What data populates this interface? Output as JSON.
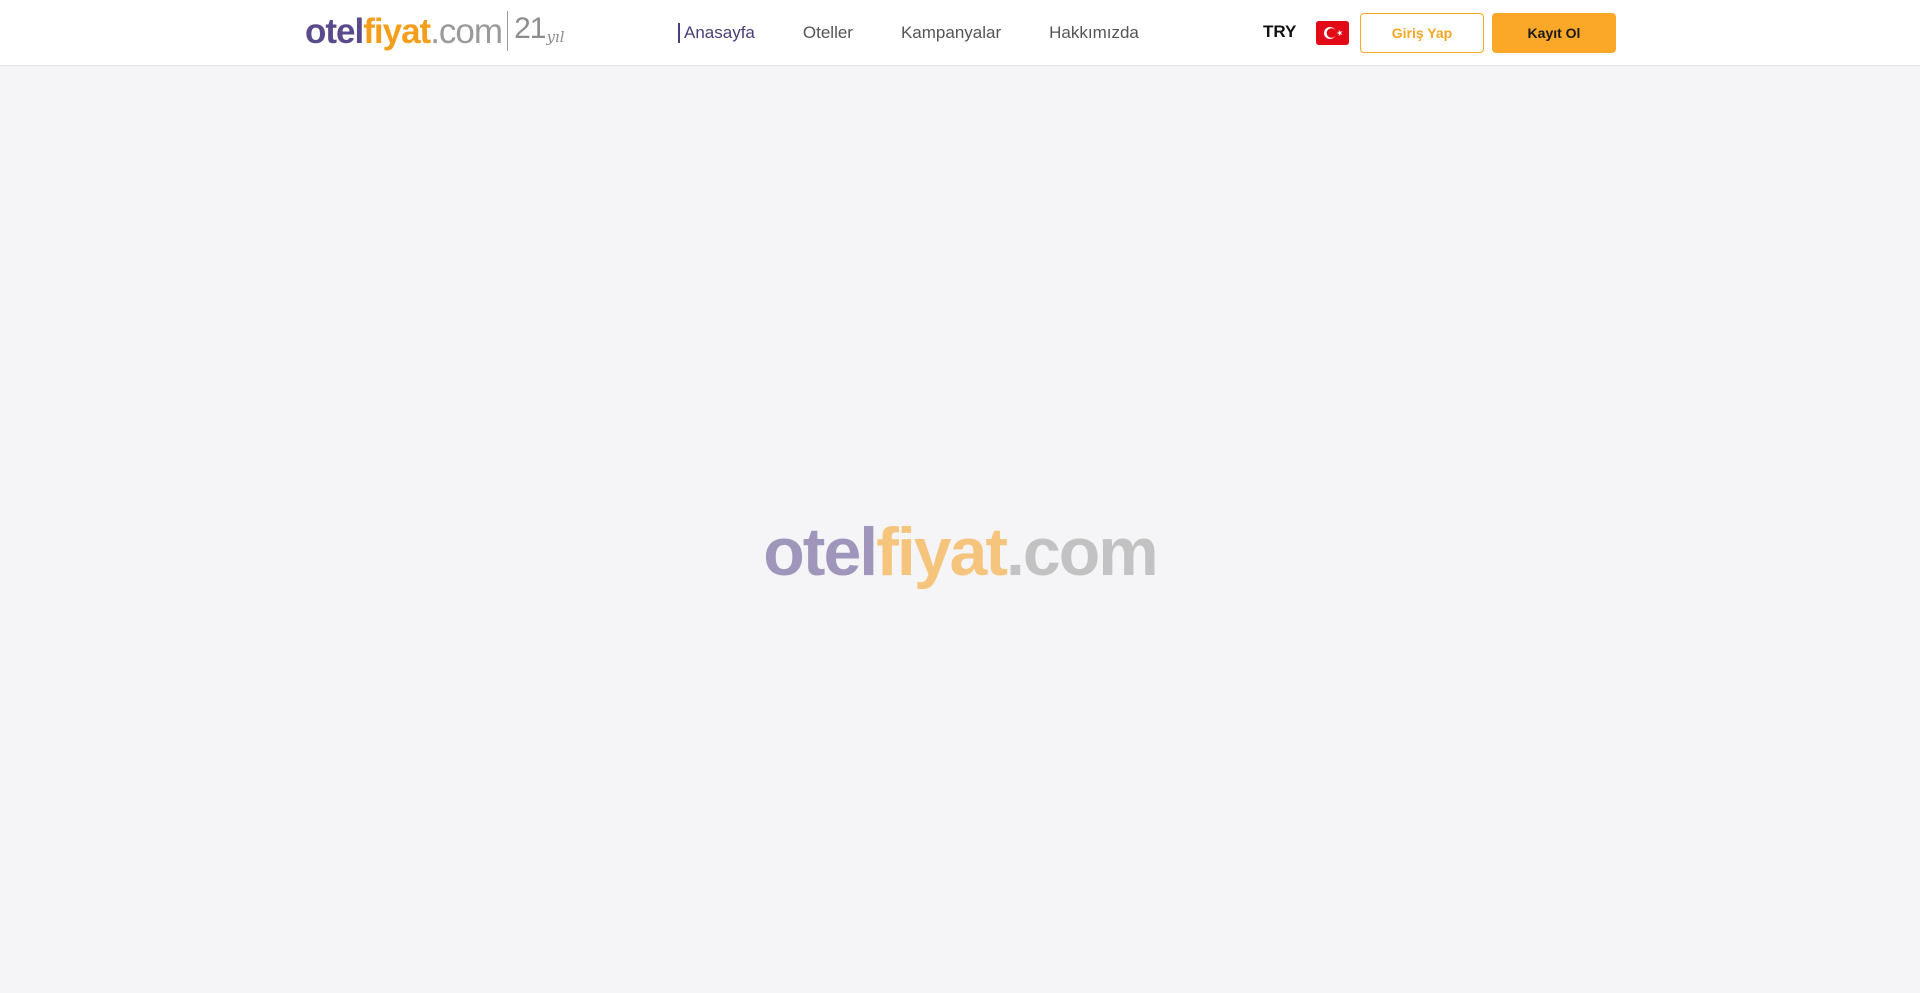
{
  "brand": {
    "part1": "otel",
    "part2": "fiyat",
    "part3": ".com",
    "years": "21",
    "years_suffix": "yıl",
    "colors": {
      "primary": "#5b4a8b",
      "accent": "#f59e1b",
      "muted": "#9a9a9a"
    }
  },
  "nav": {
    "items": [
      {
        "label": "Anasayfa",
        "active": true
      },
      {
        "label": "Oteller",
        "active": false
      },
      {
        "label": "Kampanyalar",
        "active": false
      },
      {
        "label": "Hakkımızda",
        "active": false
      }
    ]
  },
  "header_right": {
    "currency": "TRY",
    "language_flag": "turkey-flag-icon",
    "login_label": "Giriş Yap",
    "register_label": "Kayıt Ol"
  },
  "loader": {
    "part1": "otel",
    "part2": "fiyat",
    "part3": ".com"
  }
}
